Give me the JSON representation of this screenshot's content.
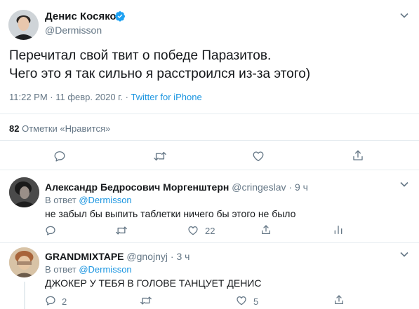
{
  "main_tweet": {
    "author_name": "Денис Косяков",
    "author_handle": "@Dermisson",
    "text_line1": "Перечитал свой твит о победе Паразитов.",
    "text_line2": "Чего это я так сильно я расстроился из-за этого)",
    "time": "11:22 PM · 11 февр. 2020 г.",
    "separator": "·",
    "source": "Twitter for iPhone",
    "likes_count": "82",
    "likes_label": "Отметки «Нравится»"
  },
  "replies": [
    {
      "author_name": "Александр Бедросович Моргенштерн",
      "author_handle": "@cringeslav",
      "time_sep": "·",
      "time": "9 ч",
      "reply_prefix": "В ответ",
      "reply_to": "@Dermisson",
      "text": "не забыл бы выпить таблетки ничего бы этого не было",
      "reply_count": "",
      "retweet_count": "",
      "like_count": "22"
    },
    {
      "author_name": "GRANDMIXTAPE",
      "author_handle": "@gnojnyj",
      "time_sep": "·",
      "time": "3 ч",
      "reply_prefix": "В ответ",
      "reply_to": "@Dermisson",
      "text": "ДЖОКЕР У ТЕБЯ В ГОЛОВЕ ТАНЦУЕТ ДЕНИС",
      "reply_count": "2",
      "retweet_count": "",
      "like_count": "5"
    }
  ],
  "colors": {
    "accent": "#1da1f2",
    "link": "#1b95e0",
    "muted": "#657786",
    "divider": "#e6ecf0"
  },
  "icons": [
    "verified-badge-icon",
    "chevron-down-icon",
    "reply-icon",
    "retweet-icon",
    "like-icon",
    "share-icon",
    "stats-icon"
  ]
}
